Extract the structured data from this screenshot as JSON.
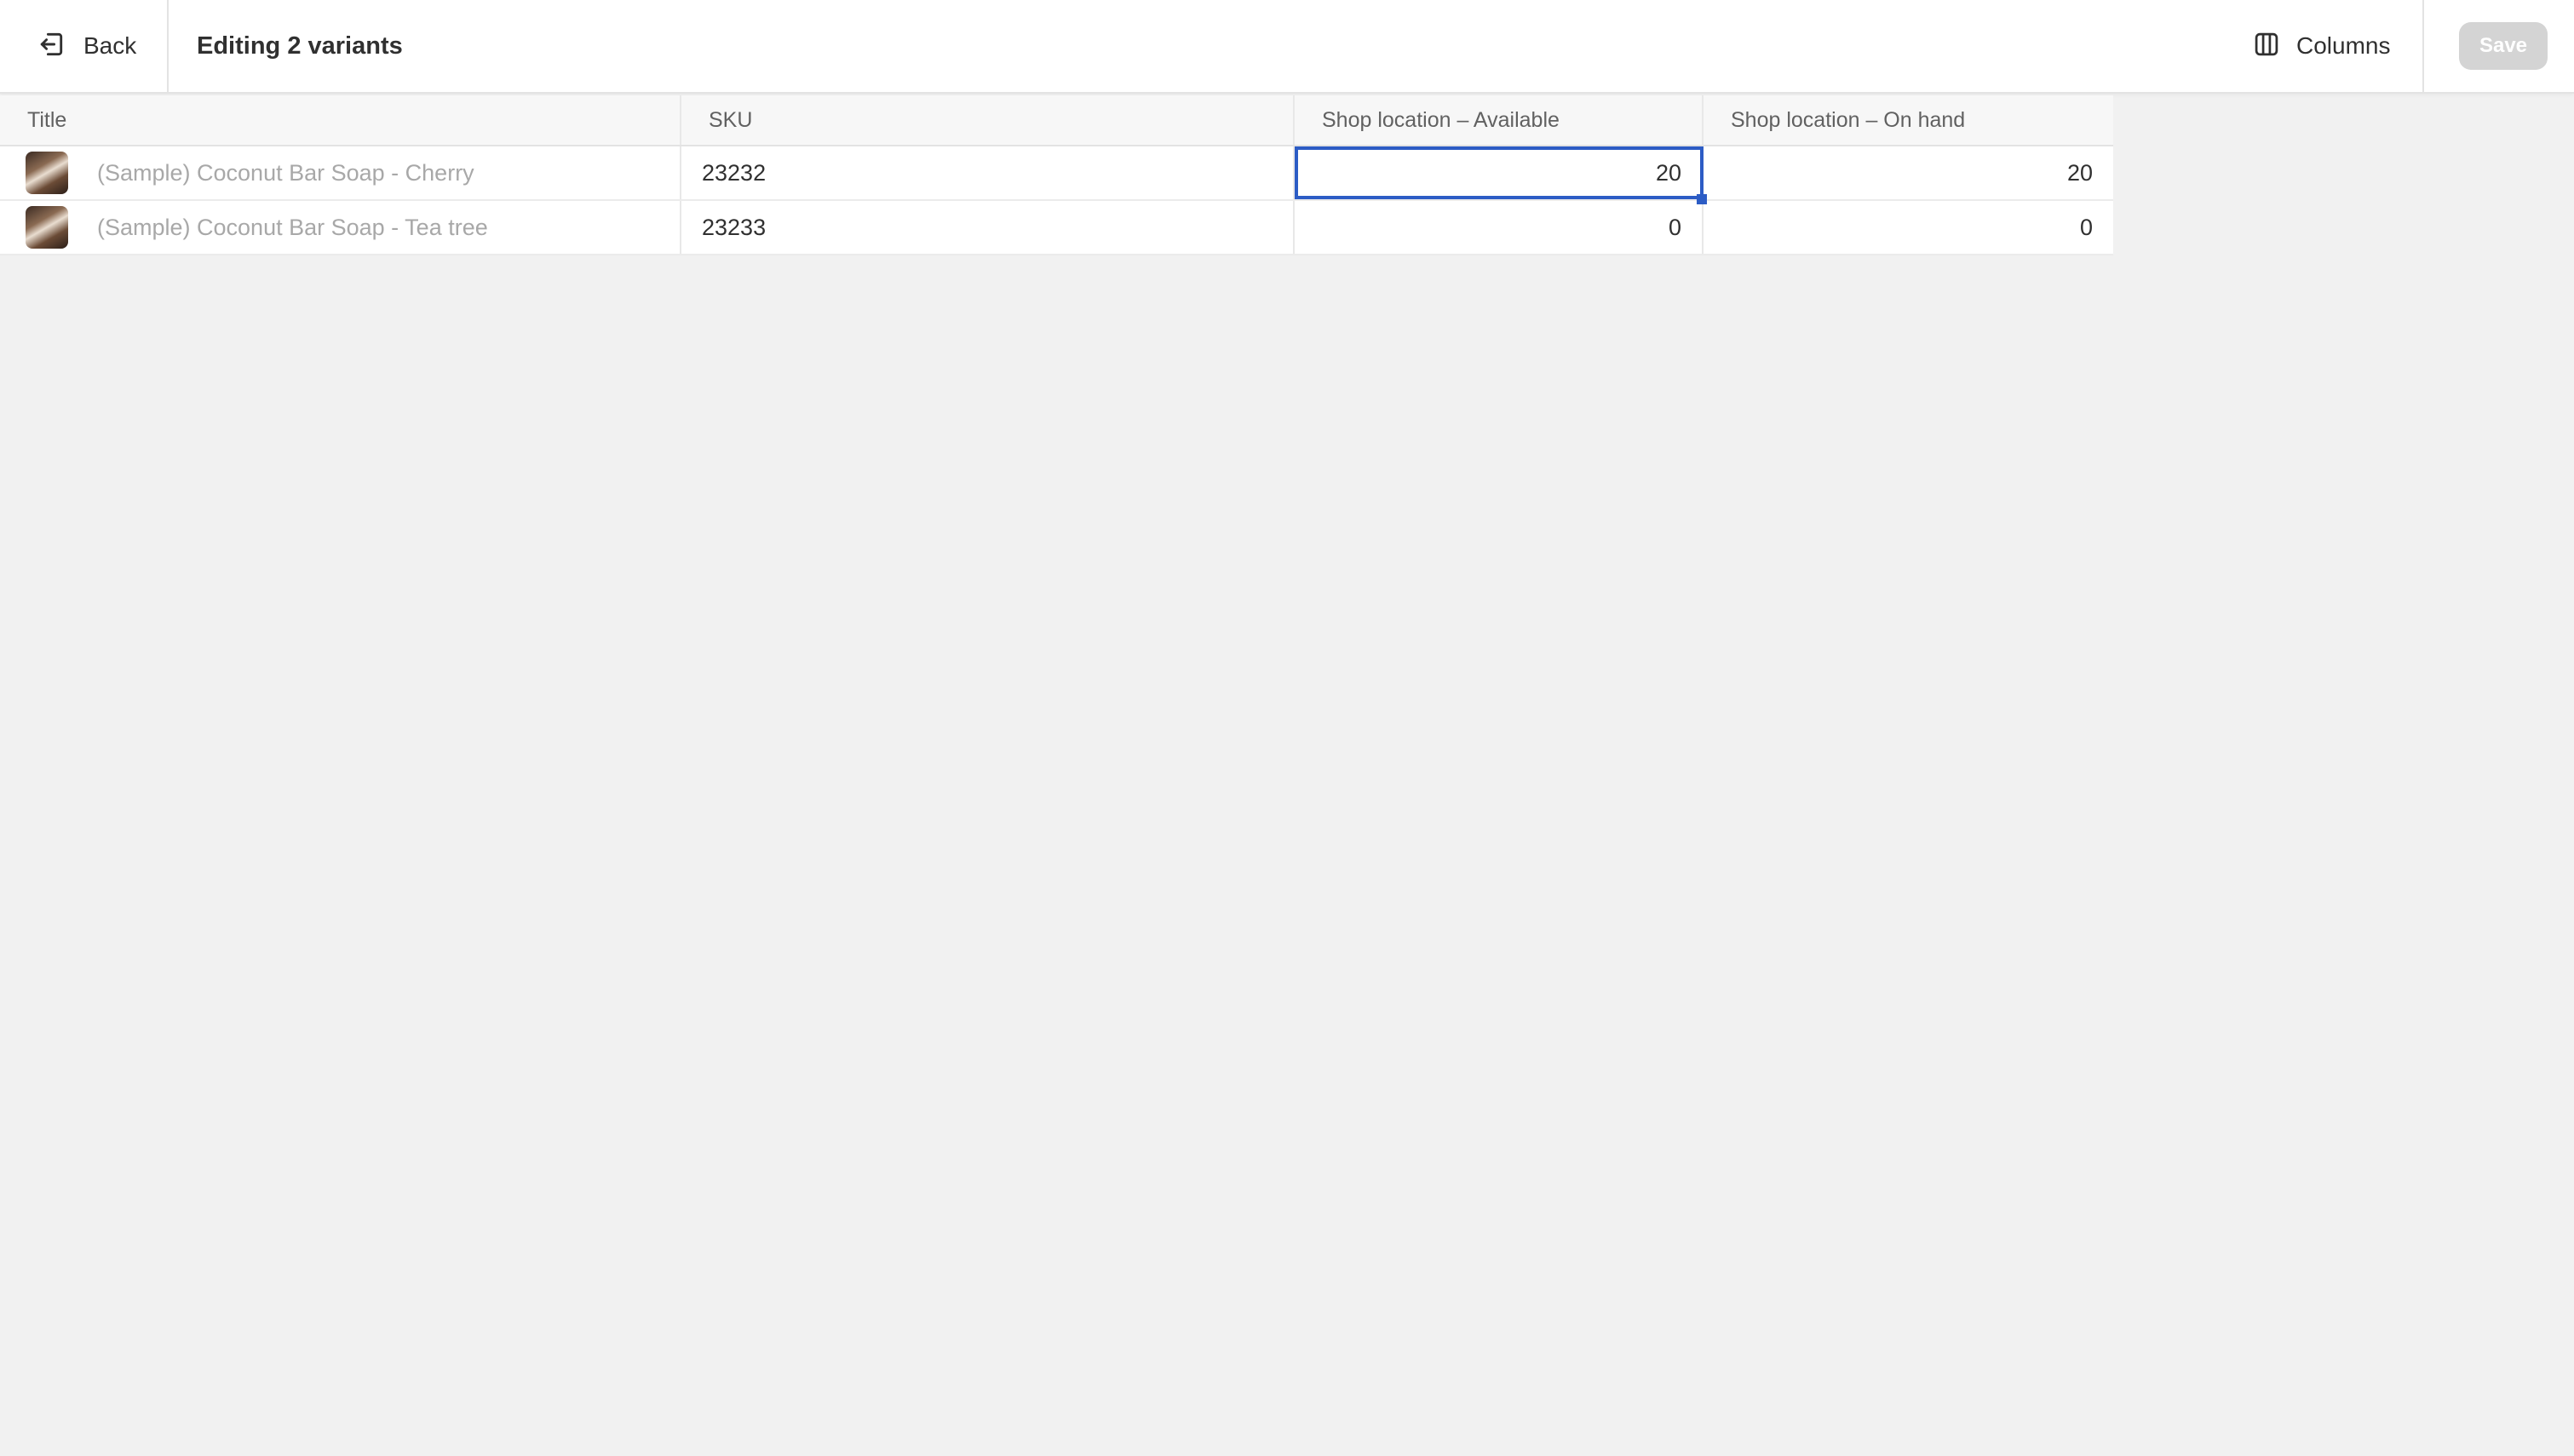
{
  "header": {
    "back_label": "Back",
    "title": "Editing 2 variants",
    "columns_label": "Columns",
    "save_label": "Save"
  },
  "grid": {
    "columns": [
      "Title",
      "SKU",
      "Shop location – Available",
      "Shop location – On hand"
    ],
    "rows": [
      {
        "title": "(Sample) Coconut Bar Soap - Cherry",
        "sku": "23232",
        "available": "20",
        "on_hand": "20"
      },
      {
        "title": "(Sample) Coconut Bar Soap - Tea tree",
        "sku": "23233",
        "available": "0",
        "on_hand": "0"
      }
    ]
  },
  "colors": {
    "selection": "#2c5cc5",
    "save_disabled": "#d4d4d4",
    "background": "#f1f1f1"
  }
}
